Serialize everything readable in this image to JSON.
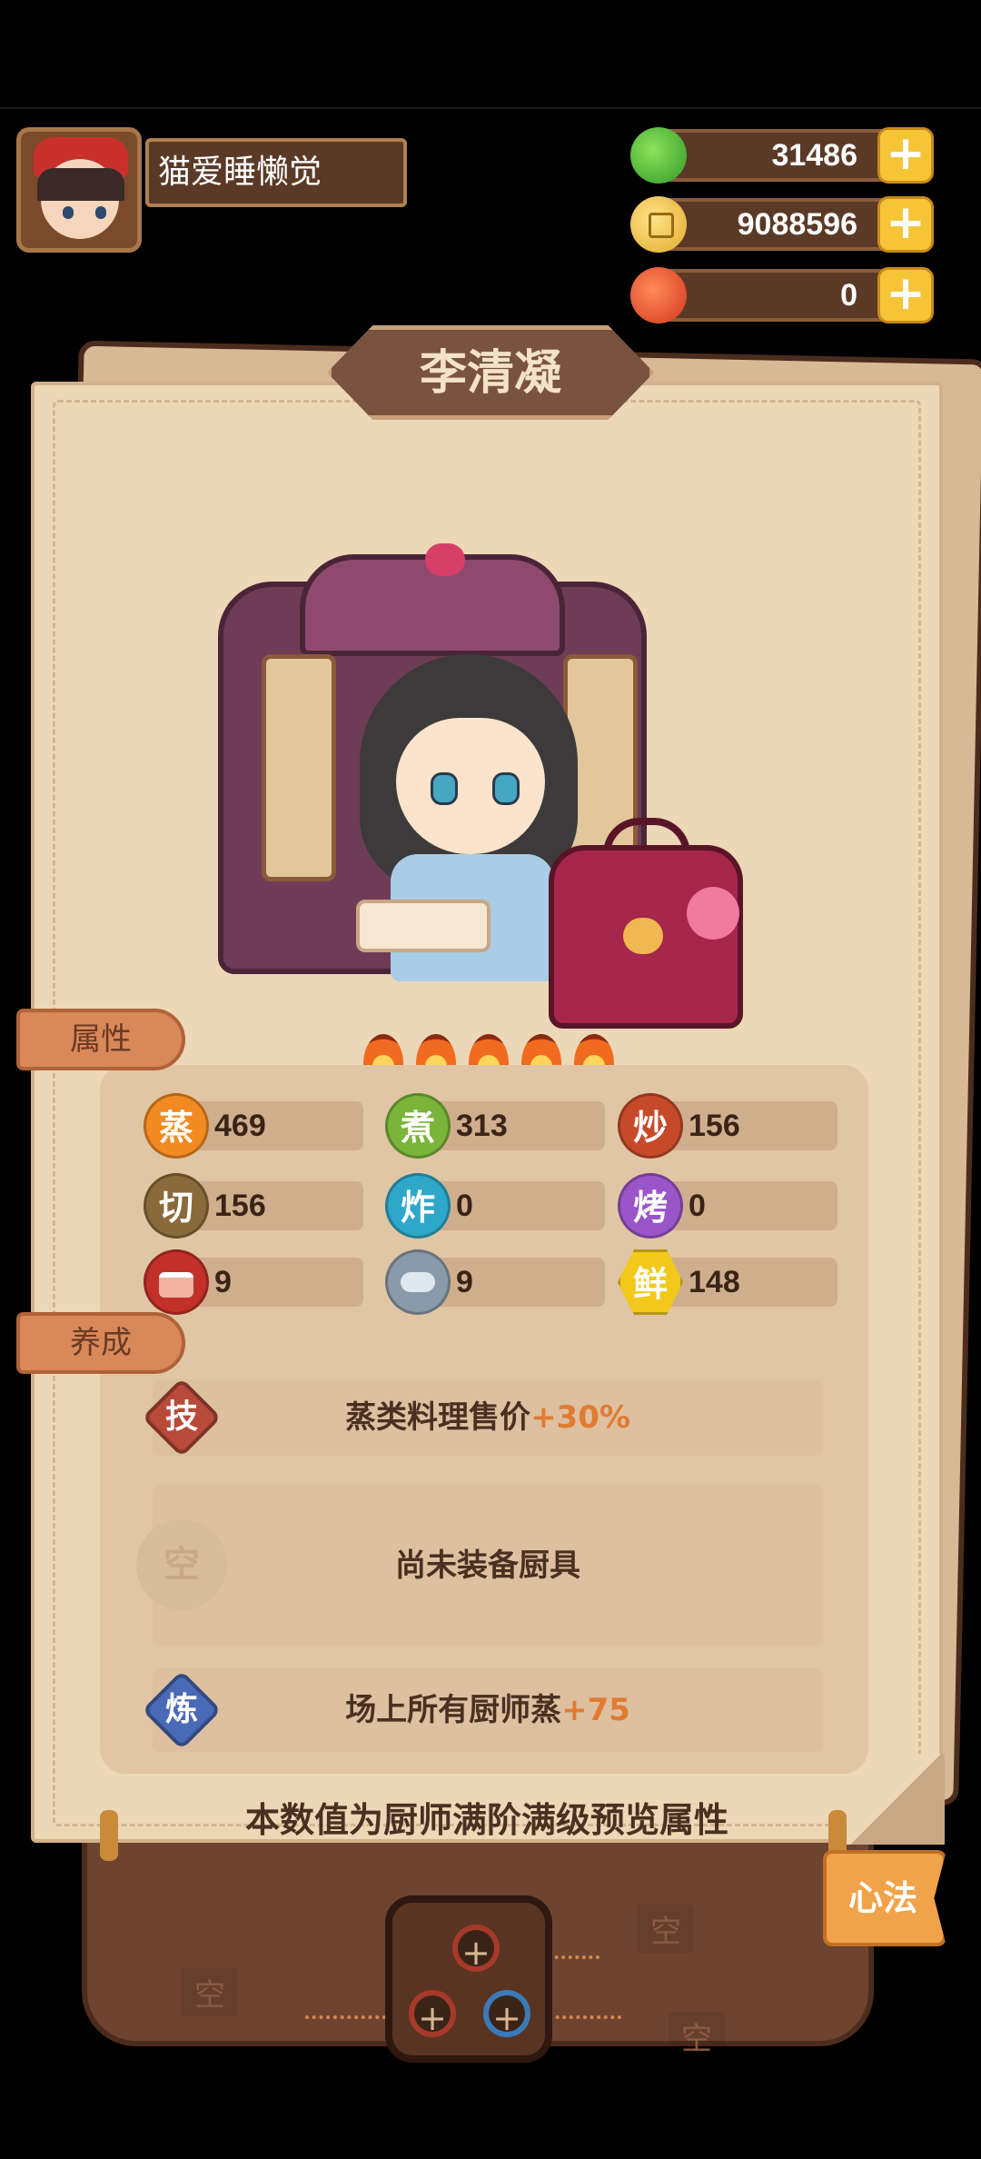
{
  "player": {
    "name": "猫爱睡懒觉",
    "avatar": "avatar"
  },
  "resources": [
    {
      "name": "jade",
      "value": "31486",
      "icon": "jade-icon",
      "color": "#4cc23a"
    },
    {
      "name": "coin",
      "value": "9088596",
      "icon": "coin-icon",
      "color": "#f2c04a"
    },
    {
      "name": "fire",
      "value": "0",
      "icon": "fire-icon",
      "color": "#e04a20"
    }
  ],
  "chef": {
    "name": "李清凝",
    "stars": 5
  },
  "tabs": {
    "attributes": "属性",
    "cultivation": "养成"
  },
  "stats": [
    {
      "label": "蒸",
      "value": "469",
      "color": "#f28a22"
    },
    {
      "label": "煮",
      "value": "313",
      "color": "#7ab53a"
    },
    {
      "label": "炒",
      "value": "156",
      "color": "#c64a2a"
    },
    {
      "label": "切",
      "value": "156",
      "color": "#8a6a3a"
    },
    {
      "label": "炸",
      "value": "0",
      "color": "#2ea7c8"
    },
    {
      "label": "烤",
      "value": "0",
      "color": "#9a55c8"
    },
    {
      "label": "",
      "value": "9",
      "color": "#c2302a",
      "icon": "meat-icon"
    },
    {
      "label": "",
      "value": "9",
      "color": "#8a9aa8",
      "icon": "fish-icon"
    },
    {
      "label": "鲜",
      "value": "148",
      "color": "#f2c81a"
    }
  ],
  "cultivation": {
    "skill_badge": "技",
    "skill_text": "蒸类料理售价",
    "skill_bonus": "+30%",
    "equip_badge": "空",
    "equip_text": "尚未装备厨具",
    "refine_badge": "炼",
    "refine_text": "场上所有厨师蒸",
    "refine_bonus": "+75"
  },
  "note": "本数值为厨师满阶满级预览属性",
  "xinfa": "心法",
  "slots": {
    "empty": "空",
    "plus": "+"
  }
}
